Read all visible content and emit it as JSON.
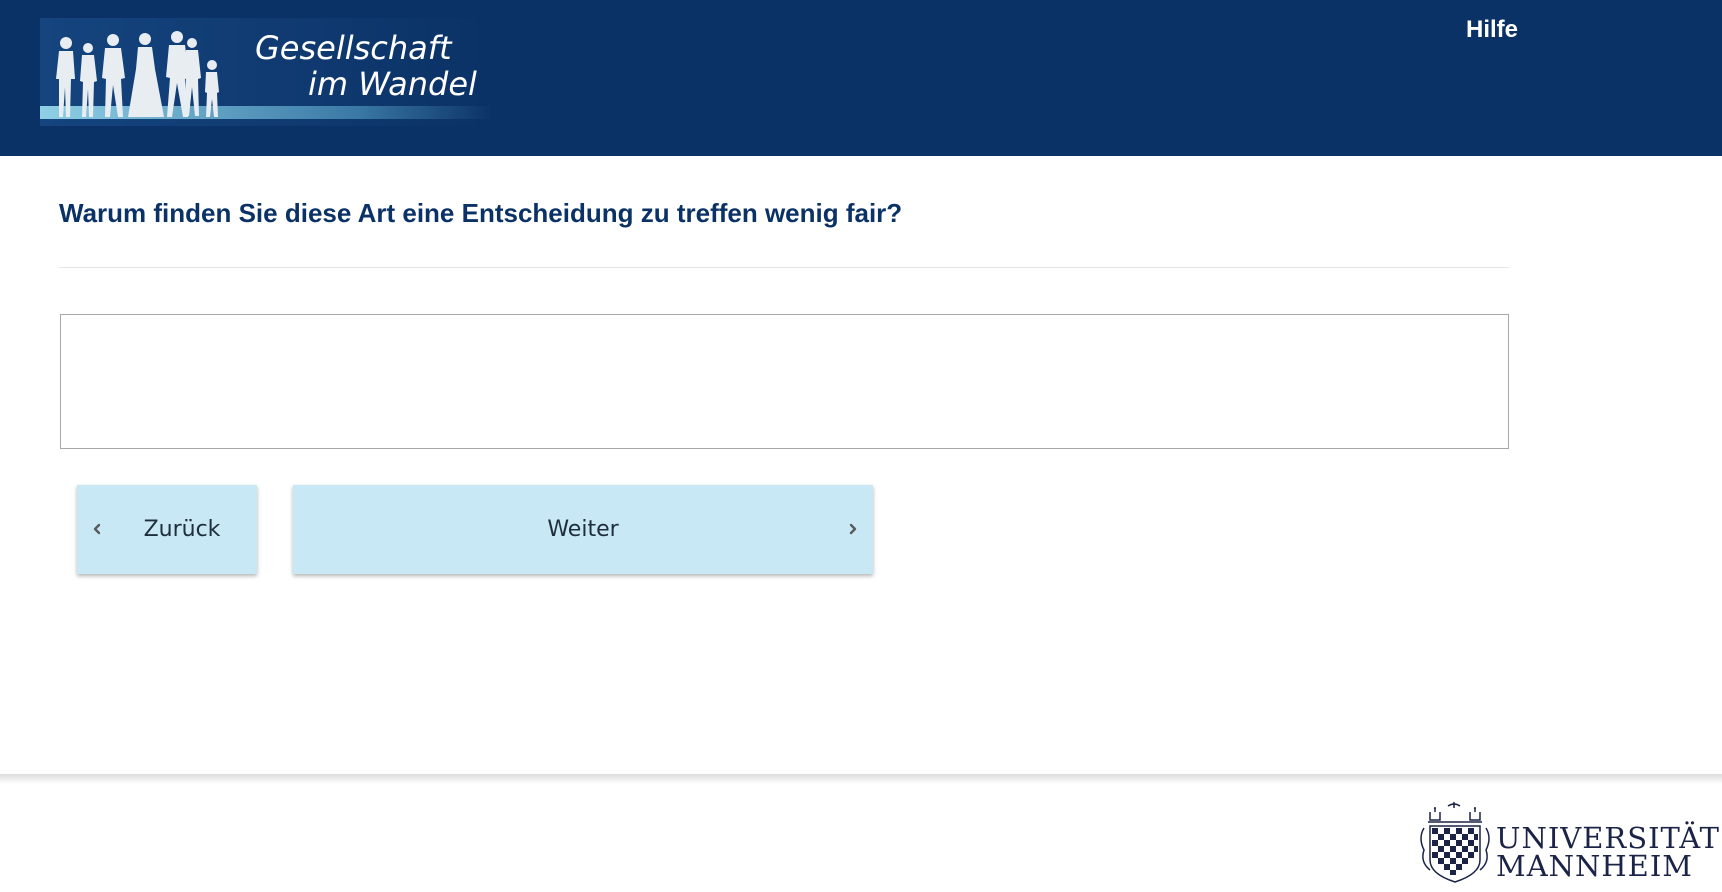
{
  "header": {
    "logo_title": "Gesellschaft",
    "logo_subtitle": "im Wandel",
    "help_label": "Hilfe",
    "background_color": "#0b3266"
  },
  "main": {
    "question": "Warum finden Sie diese Art eine Entscheidung zu treffen wenig fair?",
    "answer_value": ""
  },
  "navigation": {
    "back_label": "Zurück",
    "next_label": "Weiter",
    "button_color": "#c7e8f4"
  },
  "footer": {
    "university_line1": "UNIVERSITÄT",
    "university_line2": "MANNHEIM"
  },
  "icons": {
    "back": "chevron-left-icon",
    "next": "chevron-right-icon",
    "crest": "university-crest-icon"
  }
}
